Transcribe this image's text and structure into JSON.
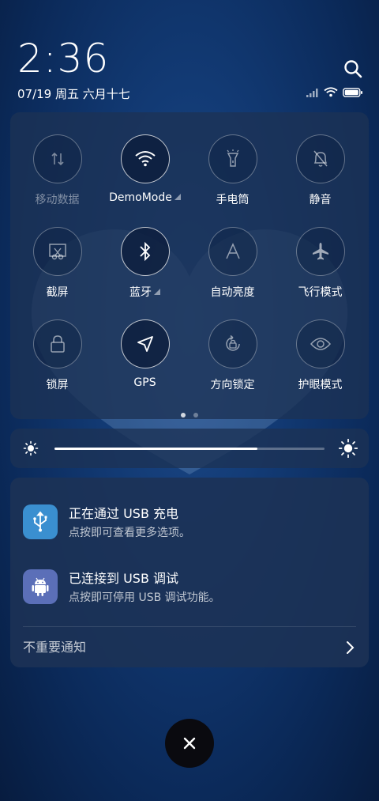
{
  "status": {
    "time": "2:36",
    "date": "07/19  周五  六月十七"
  },
  "quick_settings": [
    {
      "label": "移动数据",
      "icon": "mobile-data-icon",
      "active": false,
      "expandable": false
    },
    {
      "label": "DemoMode",
      "icon": "wifi-icon",
      "active": true,
      "expandable": true
    },
    {
      "label": "手电筒",
      "icon": "flashlight-icon",
      "active": false,
      "expandable": false
    },
    {
      "label": "静音",
      "icon": "mute-icon",
      "active": false,
      "expandable": false
    },
    {
      "label": "截屏",
      "icon": "screenshot-icon",
      "active": false,
      "expandable": false
    },
    {
      "label": "蓝牙",
      "icon": "bluetooth-icon",
      "active": true,
      "expandable": true
    },
    {
      "label": "自动亮度",
      "icon": "auto-brightness-icon",
      "active": false,
      "expandable": false
    },
    {
      "label": "飞行模式",
      "icon": "airplane-icon",
      "active": false,
      "expandable": false
    },
    {
      "label": "锁屏",
      "icon": "lock-icon",
      "active": false,
      "expandable": false
    },
    {
      "label": "GPS",
      "icon": "gps-icon",
      "active": true,
      "expandable": false
    },
    {
      "label": "方向锁定",
      "icon": "rotation-lock-icon",
      "active": false,
      "expandable": false
    },
    {
      "label": "护眼模式",
      "icon": "eye-icon",
      "active": false,
      "expandable": false
    }
  ],
  "page_indicator": {
    "pages": 2,
    "current": 0
  },
  "brightness": {
    "level": 0.75
  },
  "notifications": [
    {
      "title": "正在通过  USB  充电",
      "subtitle": "点按即可查看更多选项。",
      "icon": "usb-icon",
      "color": "#3a8fd0"
    },
    {
      "title": "已连接到  USB  调试",
      "subtitle": "点按即可停用 USB 调试功能。",
      "icon": "android-icon",
      "color": "#5b6fb8"
    }
  ],
  "unimportant_label": "不重要通知",
  "colors": {
    "panel": "#1c3255",
    "accent": "#ffffff"
  }
}
